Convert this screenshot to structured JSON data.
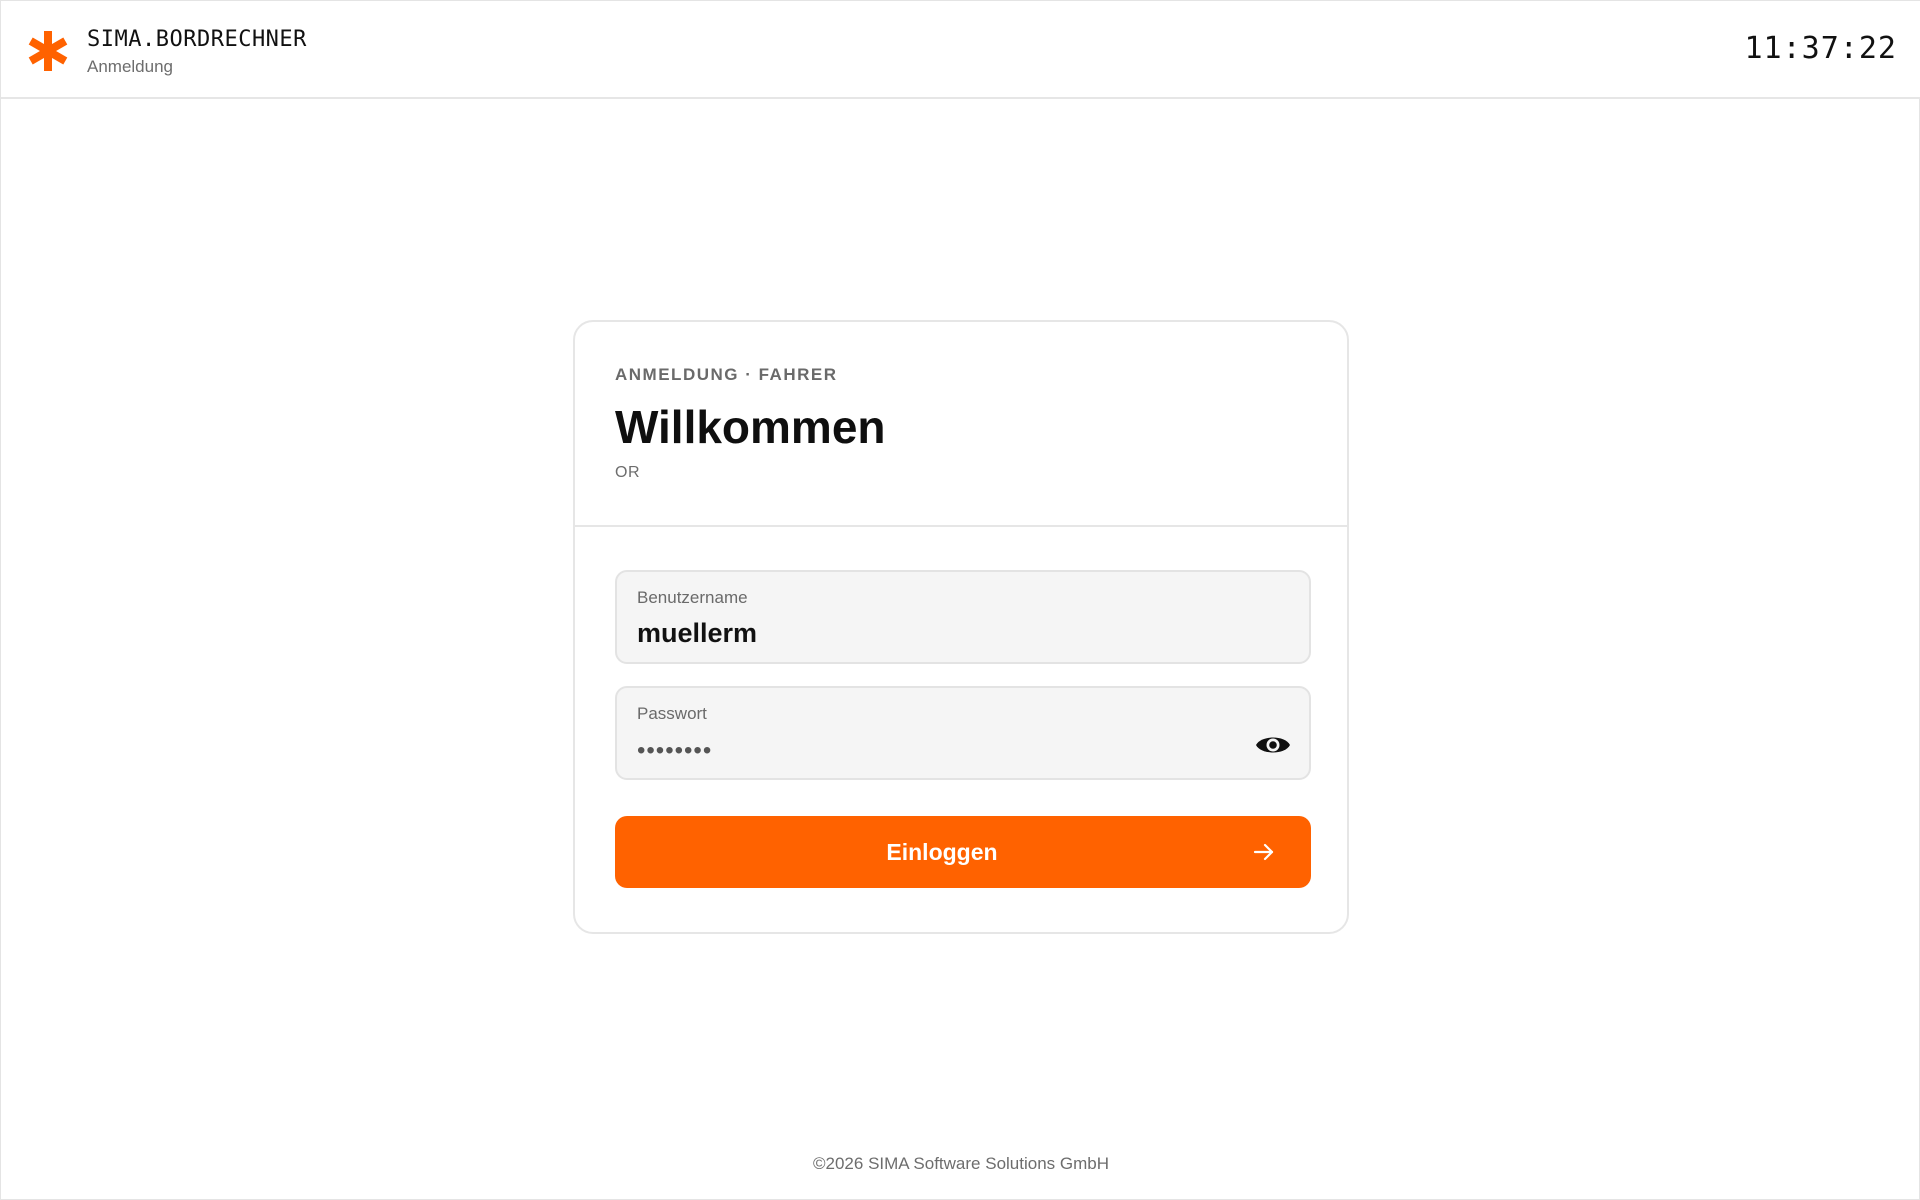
{
  "header": {
    "brand_title": "SIMA.BORDRECHNER",
    "brand_subtitle": "Anmeldung",
    "clock": "11:37:22",
    "logo_icon": "asterisk-icon",
    "accent_color": "#ff6200"
  },
  "card": {
    "eyebrow": "ANMELDUNG · FAHRER",
    "title": "Willkommen",
    "subtitle": "OR",
    "username": {
      "label": "Benutzername",
      "value": "muellerm"
    },
    "password": {
      "label": "Passwort",
      "value": "••••••••",
      "toggle_icon": "eye-icon"
    },
    "login_button": {
      "label": "Einloggen",
      "icon": "arrow-right-icon",
      "color": "#ff6200"
    }
  },
  "footer": {
    "copyright": "©2026 SIMA Software Solutions GmbH"
  }
}
